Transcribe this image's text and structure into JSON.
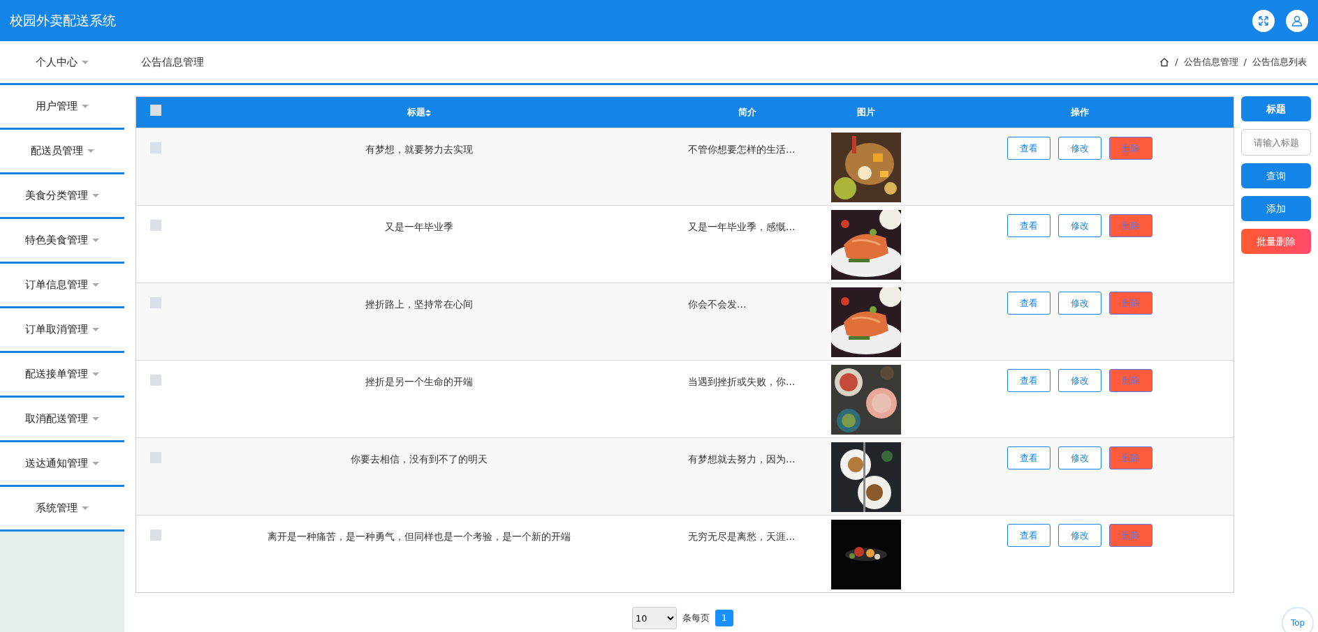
{
  "app_title": "校园外卖配送系统",
  "header_icons": [
    {
      "kind": "fullscreen"
    },
    {
      "kind": "user"
    }
  ],
  "sidebar": {
    "items": [
      {
        "label": "个人中心",
        "expanded": false
      },
      {
        "label": "用户管理",
        "expanded": false
      },
      {
        "label": "配送员管理",
        "expanded": false
      },
      {
        "label": "美食分类管理",
        "expanded": false
      },
      {
        "label": "特色美食管理",
        "expanded": false
      },
      {
        "label": "订单信息管理",
        "expanded": false
      },
      {
        "label": "订单取消管理",
        "expanded": false
      },
      {
        "label": "配送接单管理",
        "expanded": false
      },
      {
        "label": "取消配送管理",
        "expanded": false
      },
      {
        "label": "送达通知管理",
        "expanded": false
      },
      {
        "label": "系统管理",
        "expanded": false
      }
    ]
  },
  "page_title": "公告信息管理",
  "breadcrumb": {
    "separator": "/",
    "items": [
      "公告信息管理",
      "公告信息列表"
    ]
  },
  "table": {
    "select_all_checked": false,
    "columns": [
      {
        "label": "标题",
        "sortable": true
      },
      {
        "label": "简介",
        "sortable": false
      },
      {
        "label": "图片",
        "sortable": false
      },
      {
        "label": "操作",
        "sortable": false
      }
    ],
    "rows": [
      {
        "checked": false,
        "title": "有梦想，就要努力去实现",
        "summary": "不管你想要怎样的生活...",
        "picture": {
          "kind": "picture"
        },
        "actions": [
          "查看",
          "修改",
          "删除"
        ]
      },
      {
        "checked": false,
        "title": "又是一年毕业季",
        "summary": "又是一年毕业季，感慨...",
        "picture": {
          "kind": "picture"
        },
        "actions": [
          "查看",
          "修改",
          "删除"
        ]
      },
      {
        "checked": false,
        "title": "挫折路上，坚持常在心间",
        "summary": "你会不会发...",
        "picture": {
          "kind": "picture"
        },
        "actions": [
          "查看",
          "修改",
          "删除"
        ]
      },
      {
        "checked": false,
        "title": "挫折是另一个生命的开端",
        "summary": "当遇到挫折或失败，你...",
        "picture": {
          "kind": "picture"
        },
        "actions": [
          "查看",
          "修改",
          "删除"
        ]
      },
      {
        "checked": false,
        "title": "你要去相信，没有到不了的明天",
        "summary": "有梦想就去努力，因为...",
        "picture": {
          "kind": "picture"
        },
        "actions": [
          "查看",
          "修改",
          "删除"
        ]
      },
      {
        "checked": false,
        "title": "离开是一种痛苦，是一种勇气，但同样也是一个考验，是一个新的开端",
        "summary": "无穷无尽是离愁，天涯...",
        "picture": {
          "kind": "picture"
        },
        "actions": [
          "查看",
          "修改",
          "删除"
        ]
      }
    ]
  },
  "search_panel": {
    "label": "标题",
    "placeholder": "请输入标题",
    "buttons": [
      {
        "label": "查询",
        "kind": "primary"
      },
      {
        "label": "添加",
        "kind": "primary"
      },
      {
        "label": "批量删除",
        "kind": "danger"
      }
    ]
  },
  "pagination": {
    "page_size": "10",
    "page_size_label": "条每页",
    "pages": [
      {
        "label": "1",
        "selected": true
      }
    ]
  },
  "top_button": "Top"
}
